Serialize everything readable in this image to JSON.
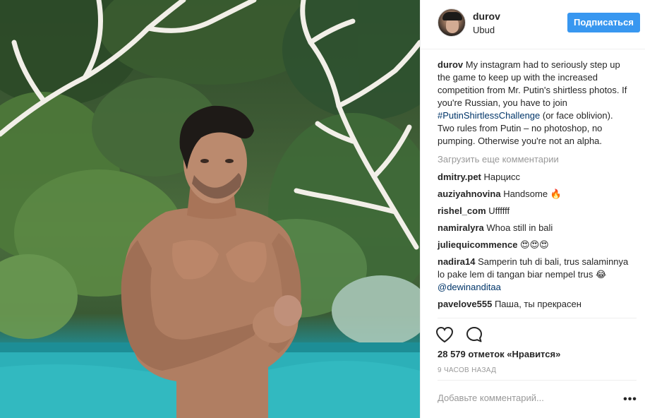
{
  "header": {
    "username": "durov",
    "location": "Ubud",
    "follow_label": "Подписаться"
  },
  "caption": {
    "username": "durov",
    "text_before": " My instagram had to seriously step up the game to keep up with the increased competition from Mr. Putin's shirtless photos. If you're Russian, you have to join ",
    "hashtag": "#PutinShirtlessChallenge",
    "text_after": " (or face oblivion). Two rules from Putin – no photoshop, no pumping. Otherwise you're not an alpha."
  },
  "load_more": "Загрузить еще комментарии",
  "comments": [
    {
      "username": "dmitry.pet",
      "text": " Нарцисс"
    },
    {
      "username": "auziyahnovina",
      "text": " Handsome 🔥"
    },
    {
      "username": "rishel_com",
      "text": " Uffffff"
    },
    {
      "username": "namiralyra",
      "text": " Whoa still in bali"
    },
    {
      "username": "juliequicommence",
      "text": " 😍😍😍"
    },
    {
      "username": "nadira14",
      "text": " Samperin tuh di bali, trus salaminnya lo pake lem di tangan biar nempel trus 😂 ",
      "mention": "@dewinanditaa"
    },
    {
      "username": "pavelove555",
      "text": " Паша, ты прекрасен"
    }
  ],
  "actions": {
    "like_icon": "heart-icon",
    "comment_icon": "speech-bubble-icon"
  },
  "likes": "28 579 отметок «Нравится»",
  "time": "9 часов назад",
  "comment_placeholder": "Добавьте комментарий...",
  "more_icon": "•••",
  "colors": {
    "accent": "#3897f0",
    "hashtag": "#003569",
    "muted": "#999999",
    "text": "#262626"
  }
}
